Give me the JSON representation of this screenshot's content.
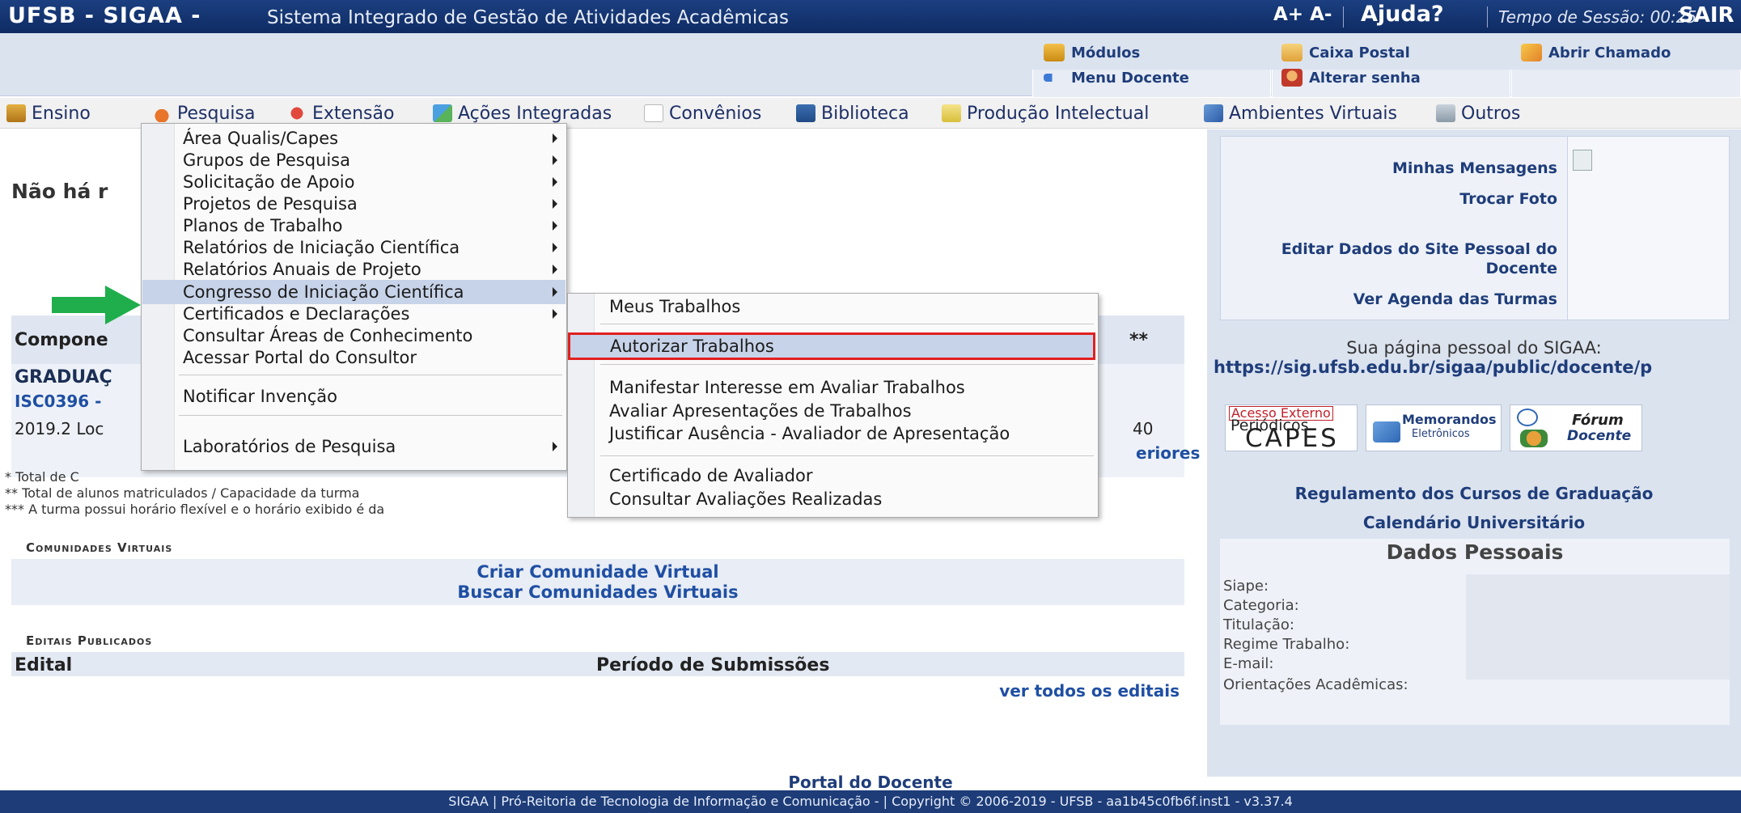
{
  "topbar": {
    "brand": "UFSB - SIGAA -",
    "subtitle": "Sistema Integrado de Gestão de Atividades Acadêmicas",
    "font_controls": "A+ A-",
    "help": "Ajuda?",
    "session": "Tempo de Sessão: 00:25",
    "logout": "SAIR"
  },
  "modules": {
    "modulos": "Módulos",
    "caixa_postal": "Caixa Postal",
    "abrir_chamado": "Abrir Chamado",
    "menu_docente": "Menu Docente",
    "alterar_senha": "Alterar senha"
  },
  "menubar": [
    "Ensino",
    "Pesquisa",
    "Extensão",
    "Ações Integradas",
    "Convênios",
    "Biblioteca",
    "Produção Intelectual",
    "Ambientes Virtuais",
    "Outros"
  ],
  "dropdown": [
    "Área Qualis/Capes",
    "Grupos de Pesquisa",
    "Solicitação de Apoio",
    "Projetos de Pesquisa",
    "Planos de Trabalho",
    "Relatórios de Iniciação Científica",
    "Relatórios Anuais de Projeto",
    "Congresso de Iniciação Científica",
    "Certificados e Declarações",
    "Consultar Áreas de Conhecimento",
    "Acessar Portal do Consultor",
    "Notificar Invenção",
    "Laboratórios de Pesquisa"
  ],
  "submenu": [
    "Meus Trabalhos",
    "Autorizar Trabalhos",
    "Manifestar Interesse em Avaliar Trabalhos",
    "Avaliar Apresentações de Trabalhos",
    "Justificar Ausência - Avaliador de Apresentação",
    "Certificado de Avaliador",
    "Consultar Avaliações Realizadas"
  ],
  "main": {
    "no_messages": "Não há r",
    "componentes": "Compone",
    "stars": "**",
    "graduacao": "GRADUAÇ",
    "code": "ISC0396 -",
    "row": "2019.2 Loc",
    "capacity": "40",
    "anteriores": "eriores",
    "note1": "* Total de C",
    "note2": "** Total de alunos matriculados / Capacidade da turma",
    "note3": "*** A turma possui horário flexível e o horário exibido é da",
    "comunidades_title": "Comunidades Virtuais",
    "criar_comunidade": "Criar Comunidade Virtual",
    "buscar_comunidades": "Buscar Comunidades Virtuais",
    "editais_title": "Editais Publicados",
    "edital_col": "Edital",
    "periodo_col": "Período de Submissões",
    "ver_todos": "ver todos os editais"
  },
  "sidebar": {
    "minhas_mensagens": "Minhas Mensagens",
    "trocar_foto": "Trocar Foto",
    "editar_dados_1": "Editar Dados do Site Pessoal do",
    "editar_dados_2": "Docente",
    "ver_agenda": "Ver Agenda das Turmas",
    "pagina_pessoal": "Sua página pessoal do SIGAA:",
    "pagina_url": "https://sig.ufsb.edu.br/sigaa/public/docente/p",
    "periodicos_1": "Acesso Externo",
    "periodicos_2": "Periódicos",
    "periodicos_3": "CAPES",
    "memorandos_1": "Memorandos",
    "memorandos_2": "Eletrônicos",
    "forum_1": "Fórum",
    "forum_2": "Docente",
    "regulamento": "Regulamento dos Cursos de Graduação",
    "calendario": "Calendário Universitário",
    "dados_title": "Dados Pessoais",
    "siape": "Siape:",
    "categoria": "Categoria:",
    "titulacao": "Titulação:",
    "regime": "Regime Trabalho:",
    "email": "E-mail:",
    "orientacoes": "Orientações Acadêmicas:"
  },
  "footer": {
    "portal": "Portal do Docente",
    "text": "SIGAA | Pró-Reitoria de Tecnologia de Informação e Comunicação -   | Copyright © 2006-2019 - UFSB - aa1b45c0fb6f.inst1 - v3.37.4"
  },
  "colors": {
    "topbar": "#17377a",
    "highlight_border": "#e02020",
    "pointer": "#1fae4b",
    "link": "#1f3d7a"
  }
}
